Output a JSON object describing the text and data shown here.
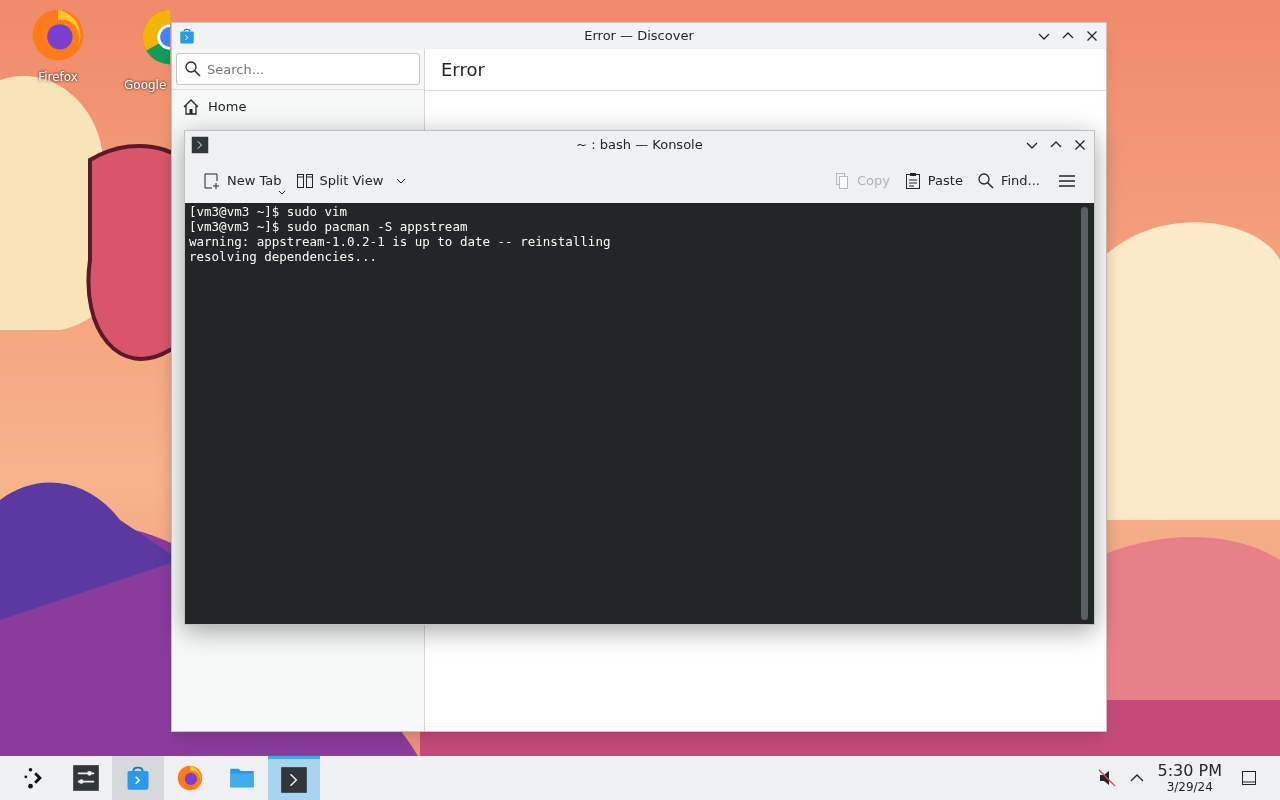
{
  "desktop": {
    "icons": [
      {
        "label": "Firefox",
        "kind": "firefox"
      },
      {
        "label": "Google",
        "kind": "chrome"
      }
    ]
  },
  "discover": {
    "title": "Error — Discover",
    "search": {
      "placeholder": "Search..."
    },
    "sidebar": {
      "items": [
        {
          "label": "Home"
        }
      ]
    },
    "page_title": "Error"
  },
  "konsole": {
    "title": "~ : bash — Konsole",
    "toolbar": [
      {
        "label": "New Tab",
        "kind": "newtab",
        "disabled": false
      },
      {
        "label": "Split View",
        "kind": "split",
        "disabled": false
      },
      {
        "label": "Copy",
        "kind": "copy",
        "disabled": true
      },
      {
        "label": "Paste",
        "kind": "paste",
        "disabled": false
      },
      {
        "label": "Find...",
        "kind": "find",
        "disabled": false
      }
    ],
    "lines": [
      "[vm3@vm3 ~]$ sudo vim",
      "[vm3@vm3 ~]$ sudo pacman -S appstream",
      "warning: appstream-1.0.2-1 is up to date -- reinstalling",
      "resolving dependencies..."
    ]
  },
  "taskbar": {
    "apps": [
      {
        "kind": "launcher",
        "open": false,
        "selected": false
      },
      {
        "kind": "settings",
        "open": false,
        "selected": false
      },
      {
        "kind": "discover",
        "open": true,
        "selected": false
      },
      {
        "kind": "firefox",
        "open": false,
        "selected": false
      },
      {
        "kind": "files",
        "open": false,
        "selected": false
      },
      {
        "kind": "konsole",
        "open": true,
        "selected": true
      }
    ],
    "volume": {
      "muted": true
    },
    "clock": {
      "time": "5:30 PM",
      "date": "3/29/24"
    }
  }
}
